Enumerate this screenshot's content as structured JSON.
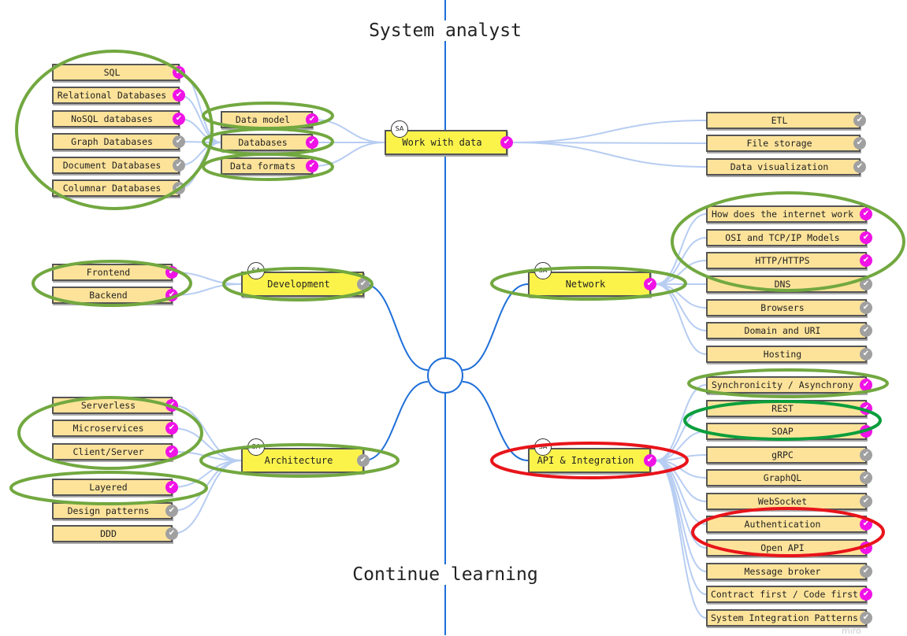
{
  "titles": {
    "top": "System analyst",
    "bottom": "Continue learning"
  },
  "watermark": "miro",
  "badge_label": "SA",
  "colors": {
    "done": "#f012e6",
    "todo": "#a0a0a0",
    "main_node": "#fbf34a",
    "sub_node": "#fde39a",
    "spine": "#1e6fd9",
    "connector": "#b7cdf2",
    "annotation_green": "#72a840",
    "annotation_bright_green": "#0a9e3c",
    "annotation_red": "#e8141a"
  },
  "icons": {
    "done": "check-circle-magenta-icon",
    "todo": "check-circle-gray-icon"
  },
  "branches": {
    "work_with_data": {
      "label": "Work with data",
      "status": "done",
      "children": [
        {
          "label": "Data model",
          "status": "done"
        },
        {
          "label": "Databases",
          "status": "done",
          "children": [
            {
              "label": "SQL",
              "status": "done"
            },
            {
              "label": "Relational Databases",
              "status": "done"
            },
            {
              "label": "NoSQL databases",
              "status": "done"
            },
            {
              "label": "Graph Databases",
              "status": "todo"
            },
            {
              "label": "Document Databases",
              "status": "todo"
            },
            {
              "label": "Columnar Databases",
              "status": "todo"
            }
          ]
        },
        {
          "label": "Data formats",
          "status": "done"
        },
        {
          "label": "ETL",
          "status": "todo"
        },
        {
          "label": "File storage",
          "status": "todo"
        },
        {
          "label": "Data visualization",
          "status": "todo"
        }
      ]
    },
    "development": {
      "label": "Development",
      "status": "todo",
      "children": [
        {
          "label": "Frontend",
          "status": "done"
        },
        {
          "label": "Backend",
          "status": "done"
        }
      ]
    },
    "network": {
      "label": "Network",
      "status": "done",
      "children": [
        {
          "label": "How does the internet work",
          "status": "done"
        },
        {
          "label": "OSI and TCP/IP Models",
          "status": "done"
        },
        {
          "label": "HTTP/HTTPS",
          "status": "done"
        },
        {
          "label": "DNS",
          "status": "todo"
        },
        {
          "label": "Browsers",
          "status": "todo"
        },
        {
          "label": "Domain and URI",
          "status": "todo"
        },
        {
          "label": "Hosting",
          "status": "todo"
        }
      ]
    },
    "architecture": {
      "label": "Architecture",
      "status": "todo",
      "children": [
        {
          "label": "Serverless",
          "status": "done"
        },
        {
          "label": "Microservices",
          "status": "done"
        },
        {
          "label": "Client/Server",
          "status": "done"
        },
        {
          "label": "Layered",
          "status": "done"
        },
        {
          "label": "Design patterns",
          "status": "todo"
        },
        {
          "label": "DDD",
          "status": "todo"
        }
      ]
    },
    "api_integration": {
      "label": "API & Integration",
      "status": "done",
      "children": [
        {
          "label": "Synchronicity / Asynchrony",
          "status": "done"
        },
        {
          "label": "REST",
          "status": "done"
        },
        {
          "label": "SOAP",
          "status": "done"
        },
        {
          "label": "gRPC",
          "status": "todo"
        },
        {
          "label": "GraphQL",
          "status": "todo"
        },
        {
          "label": "WebSocket",
          "status": "todo"
        },
        {
          "label": "Authentication",
          "status": "done"
        },
        {
          "label": "Open API",
          "status": "done"
        },
        {
          "label": "Message broker",
          "status": "todo"
        },
        {
          "label": "Contract first / Code first",
          "status": "done"
        },
        {
          "label": "System Integration Patterns",
          "status": "todo"
        }
      ]
    }
  }
}
